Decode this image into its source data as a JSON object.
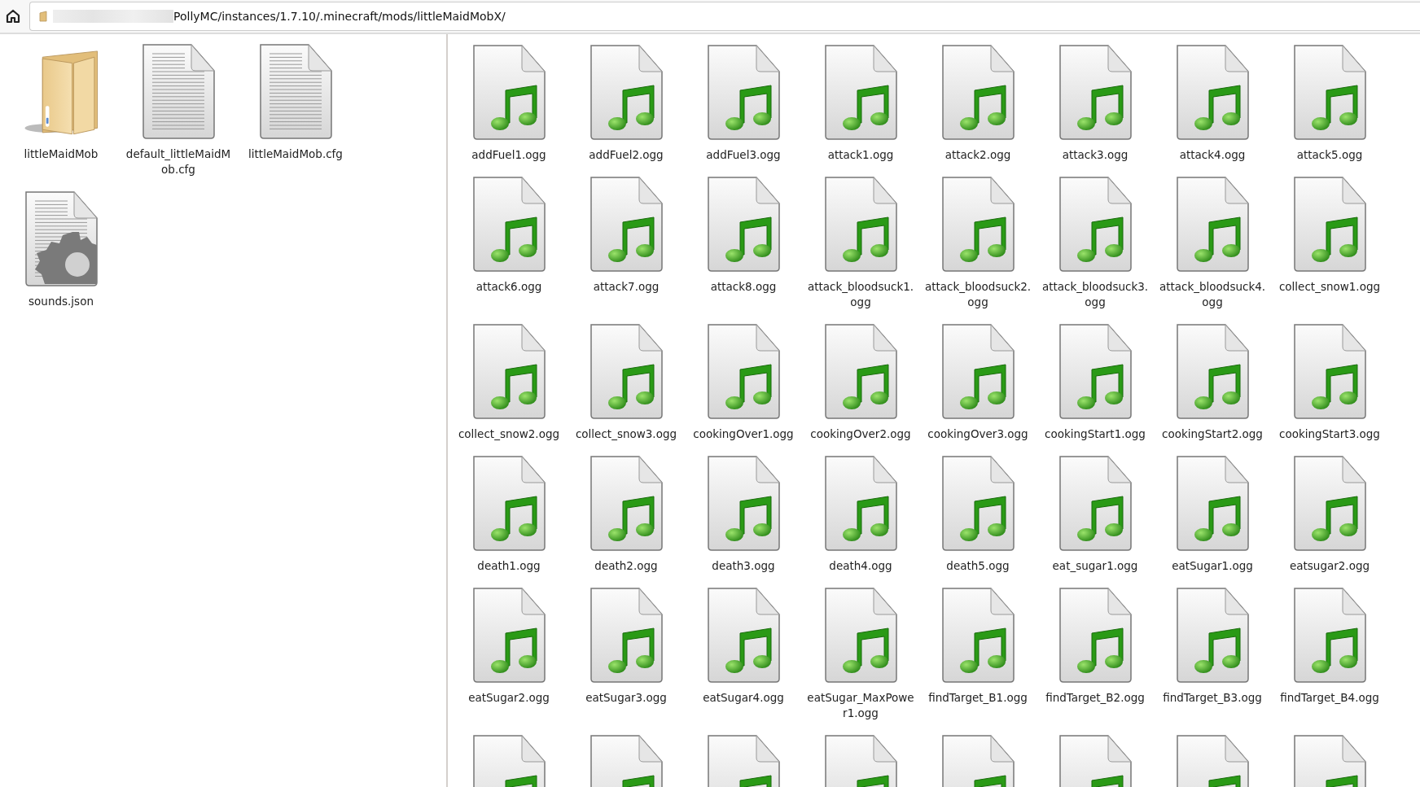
{
  "address_bar": {
    "path": "PollyMC/instances/1.7.10/.minecraft/mods/littleMaidMobX/",
    "redacted_prefix": true
  },
  "left_pane": {
    "items": [
      {
        "kind": "folder",
        "name": "littleMaidMob"
      },
      {
        "kind": "text",
        "name": "default_littleMaidMob.cfg"
      },
      {
        "kind": "text",
        "name": "littleMaidMob.cfg"
      },
      {
        "kind": "config",
        "name": "sounds.json"
      }
    ]
  },
  "right_pane": {
    "items": [
      {
        "kind": "audio",
        "name": "addFuel1.ogg"
      },
      {
        "kind": "audio",
        "name": "addFuel2.ogg"
      },
      {
        "kind": "audio",
        "name": "addFuel3.ogg"
      },
      {
        "kind": "audio",
        "name": "attack1.ogg"
      },
      {
        "kind": "audio",
        "name": "attack2.ogg"
      },
      {
        "kind": "audio",
        "name": "attack3.ogg"
      },
      {
        "kind": "audio",
        "name": "attack4.ogg"
      },
      {
        "kind": "audio",
        "name": "attack5.ogg"
      },
      {
        "kind": "audio",
        "name": "attack6.ogg"
      },
      {
        "kind": "audio",
        "name": "attack7.ogg"
      },
      {
        "kind": "audio",
        "name": "attack8.ogg"
      },
      {
        "kind": "audio",
        "name": "attack_bloodsuck1.ogg"
      },
      {
        "kind": "audio",
        "name": "attack_bloodsuck2.ogg"
      },
      {
        "kind": "audio",
        "name": "attack_bloodsuck3.ogg"
      },
      {
        "kind": "audio",
        "name": "attack_bloodsuck4.ogg"
      },
      {
        "kind": "audio",
        "name": "collect_snow1.ogg"
      },
      {
        "kind": "audio",
        "name": "collect_snow2.ogg"
      },
      {
        "kind": "audio",
        "name": "collect_snow3.ogg"
      },
      {
        "kind": "audio",
        "name": "cookingOver1.ogg"
      },
      {
        "kind": "audio",
        "name": "cookingOver2.ogg"
      },
      {
        "kind": "audio",
        "name": "cookingOver3.ogg"
      },
      {
        "kind": "audio",
        "name": "cookingStart1.ogg"
      },
      {
        "kind": "audio",
        "name": "cookingStart2.ogg"
      },
      {
        "kind": "audio",
        "name": "cookingStart3.ogg"
      },
      {
        "kind": "audio",
        "name": "death1.ogg"
      },
      {
        "kind": "audio",
        "name": "death2.ogg"
      },
      {
        "kind": "audio",
        "name": "death3.ogg"
      },
      {
        "kind": "audio",
        "name": "death4.ogg"
      },
      {
        "kind": "audio",
        "name": "death5.ogg"
      },
      {
        "kind": "audio",
        "name": "eat_sugar1.ogg"
      },
      {
        "kind": "audio",
        "name": "eatSugar1.ogg"
      },
      {
        "kind": "audio",
        "name": "eatsugar2.ogg"
      },
      {
        "kind": "audio",
        "name": "eatSugar2.ogg"
      },
      {
        "kind": "audio",
        "name": "eatSugar3.ogg"
      },
      {
        "kind": "audio",
        "name": "eatSugar4.ogg"
      },
      {
        "kind": "audio",
        "name": "eatSugar_MaxPower1.ogg"
      },
      {
        "kind": "audio",
        "name": "findTarget_B1.ogg"
      },
      {
        "kind": "audio",
        "name": "findTarget_B2.ogg"
      },
      {
        "kind": "audio",
        "name": "findTarget_B3.ogg"
      },
      {
        "kind": "audio",
        "name": "findTarget_B4.ogg"
      },
      {
        "kind": "audio"
      },
      {
        "kind": "audio"
      },
      {
        "kind": "audio"
      },
      {
        "kind": "audio"
      },
      {
        "kind": "audio"
      },
      {
        "kind": "audio"
      },
      {
        "kind": "audio"
      },
      {
        "kind": "audio"
      }
    ]
  }
}
